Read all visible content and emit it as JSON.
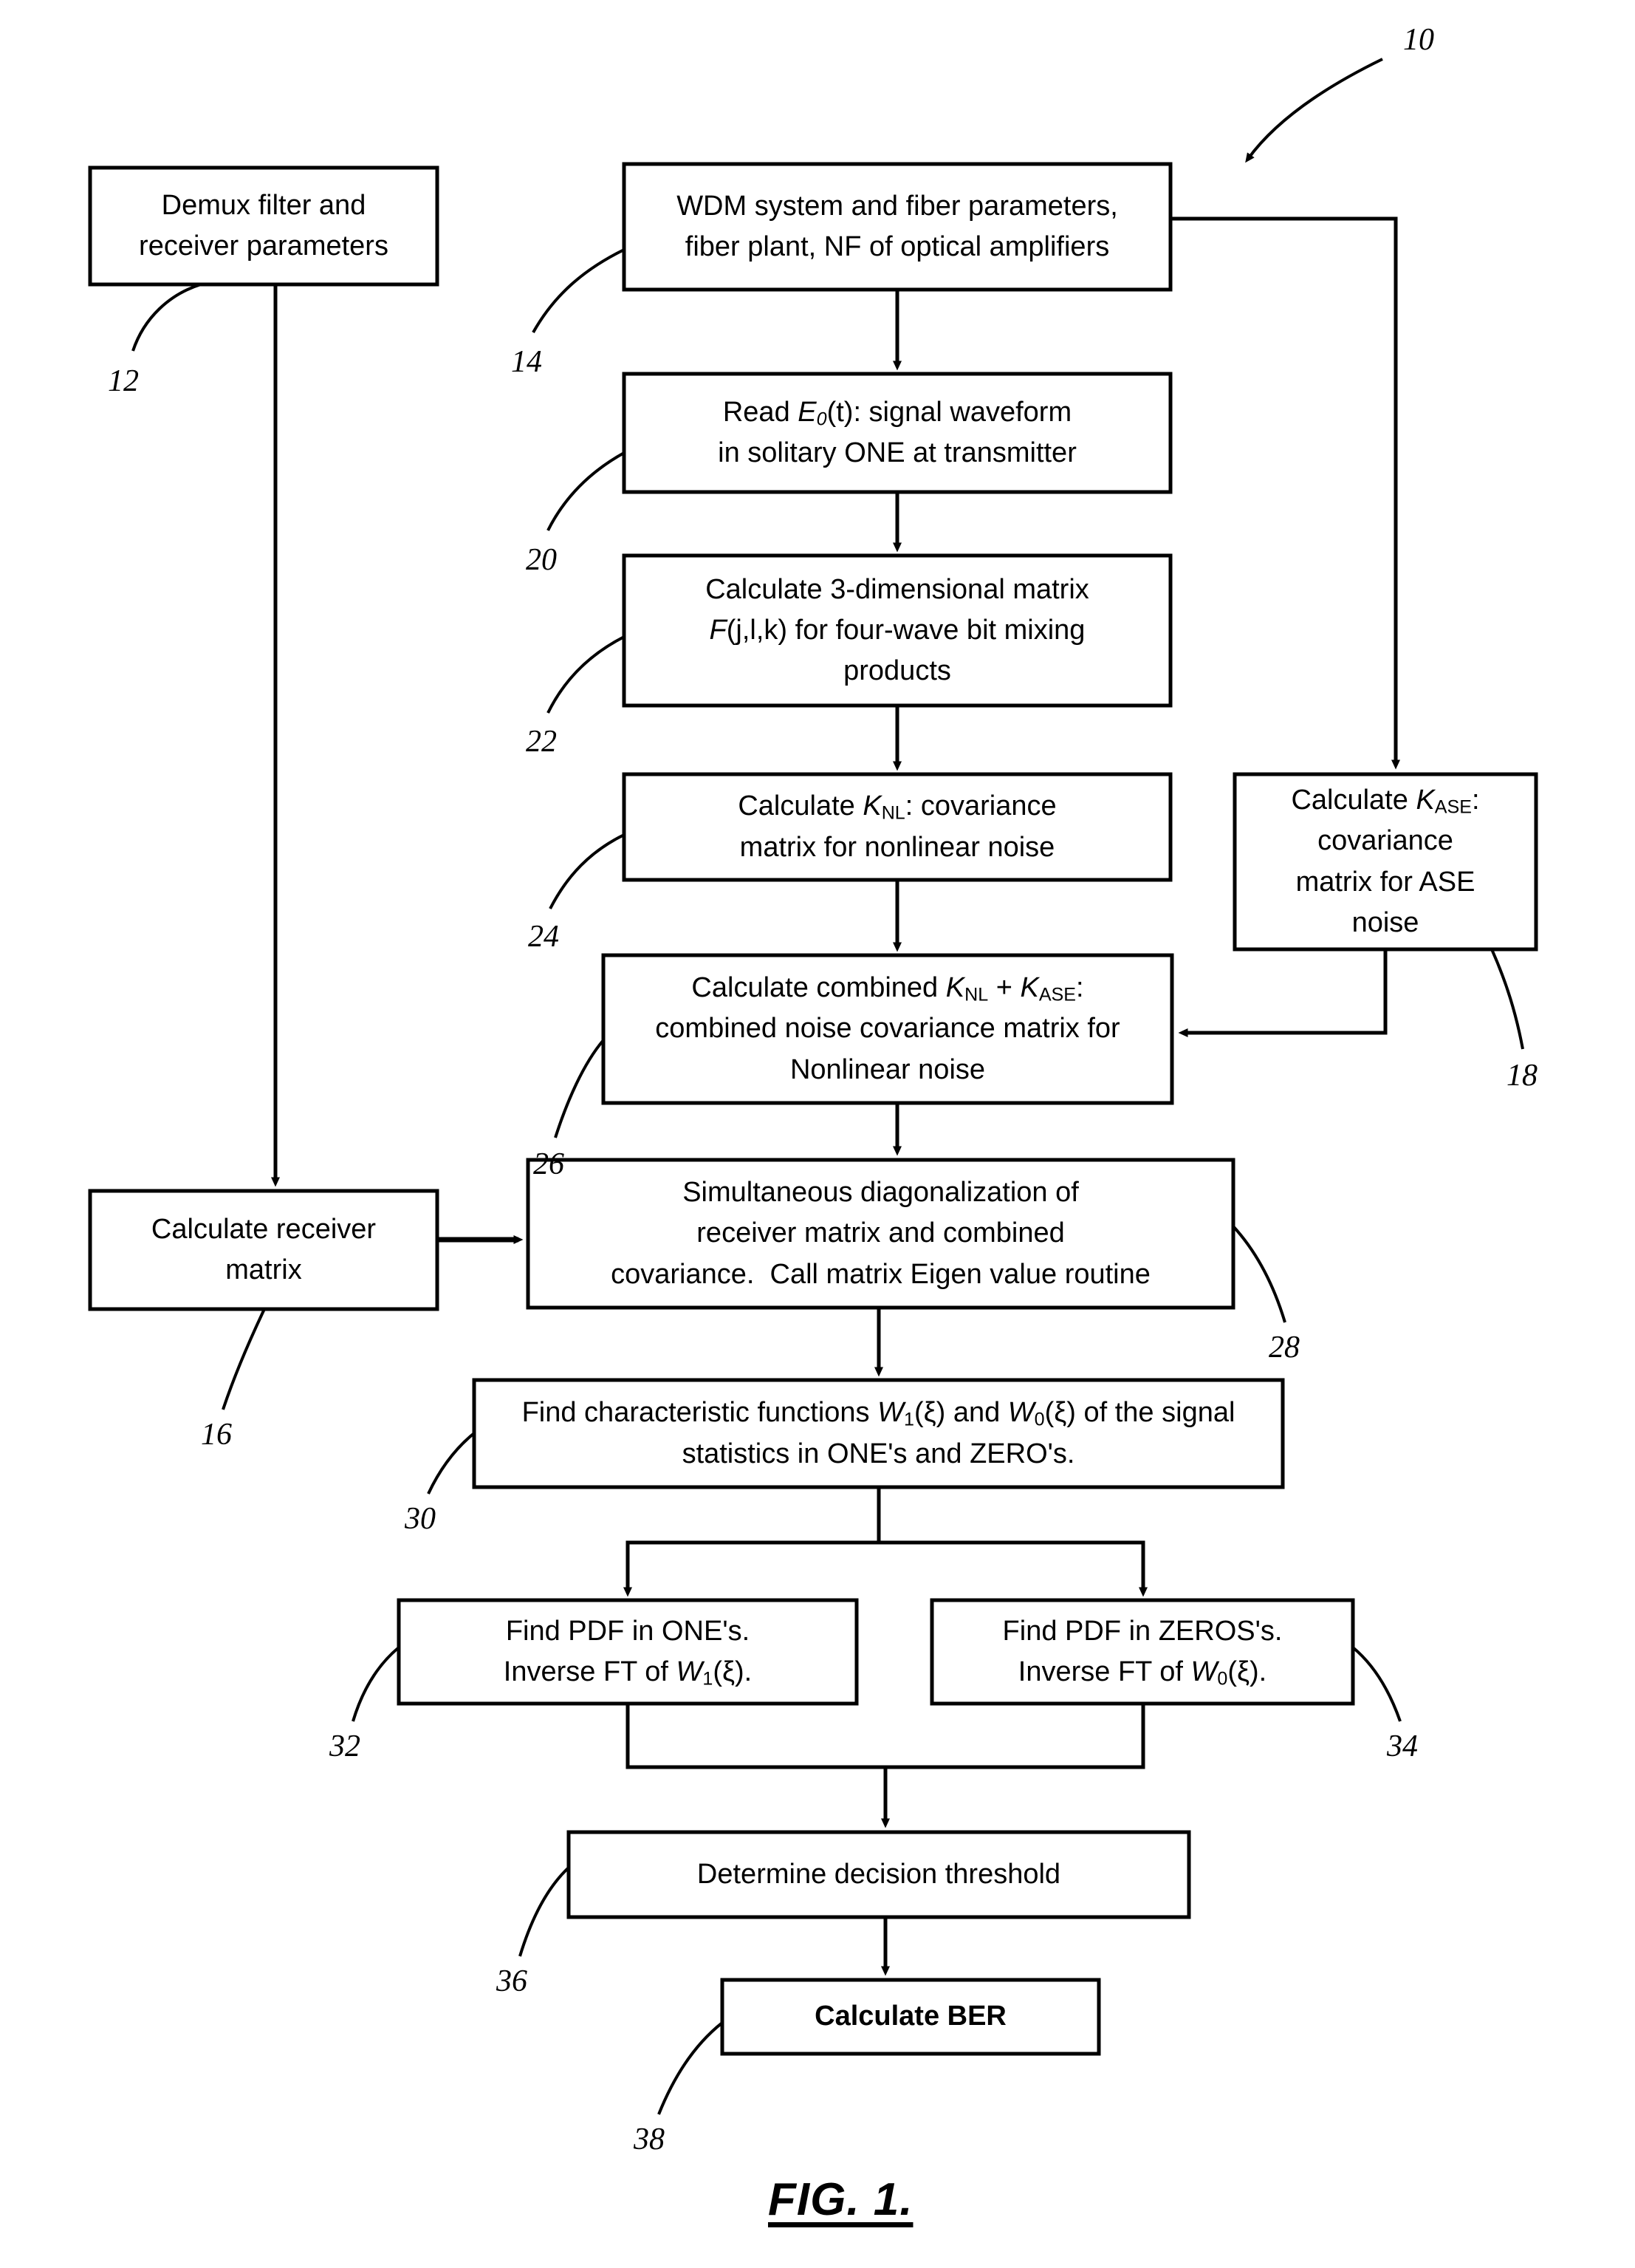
{
  "figure": {
    "caption": "FIG. 1.",
    "system_ref": "10"
  },
  "nodes": [
    {
      "id": "demux",
      "ref": "12",
      "lines": [
        "Demux filter and",
        "receiver parameters"
      ],
      "style": "plain"
    },
    {
      "id": "wdm",
      "ref": "14",
      "lines": [
        "WDM system and fiber parameters,",
        "fiber plant, NF of optical amplifiers"
      ],
      "style": "plain"
    },
    {
      "id": "read-e0",
      "ref": "20",
      "lines": [
        "Read E0(t): signal waveform",
        "in solitary ONE at transmitter"
      ],
      "html": "Read <i>E</i><sub><i>0</i></sub>(t): signal waveform<br>in solitary ONE at transmitter",
      "style": "math"
    },
    {
      "id": "matrix-f",
      "ref": "22",
      "lines": [
        "Calculate 3-dimensional matrix",
        "F(j,l,k) for four-wave bit mixing",
        "products"
      ],
      "html": "Calculate 3-dimensional matrix<br><i>F</i>(j,l,k) for four-wave bit mixing<br>products",
      "style": "math"
    },
    {
      "id": "k-nl",
      "ref": "24",
      "lines": [
        "Calculate KNL: covariance",
        "matrix for nonlinear noise"
      ],
      "html": "Calculate <i>K</i><sub>NL</sub>: covariance<br>matrix for nonlinear noise",
      "style": "math"
    },
    {
      "id": "k-ase",
      "ref": "18",
      "lines": [
        "Calculate KASE:",
        "covariance",
        "matrix for ASE",
        "noise"
      ],
      "html": "Calculate <i>K</i><sub>ASE</sub>:<br>covariance<br>matrix for ASE<br>noise",
      "style": "math"
    },
    {
      "id": "combined",
      "ref": "26",
      "lines": [
        "Calculate combined KNL + KASE:",
        "combined noise covariance matrix for",
        "Nonlinear noise"
      ],
      "html": "Calculate combined <i>K</i><sub>NL</sub> + <i>K</i><sub>ASE</sub>:<br>combined noise covariance matrix for<br>Nonlinear noise",
      "style": "math"
    },
    {
      "id": "receiver-matrix",
      "ref": "16",
      "lines": [
        "Calculate receiver",
        "matrix"
      ],
      "style": "plain"
    },
    {
      "id": "diagonalization",
      "ref": "28",
      "lines": [
        "Simultaneous diagonalization of",
        "receiver matrix and combined",
        "covariance.  Call matrix Eigen value routine"
      ],
      "html": "Simultaneous diagonalization of<br>receiver matrix and combined<br>covariance.&nbsp; Call matrix Eigen value routine",
      "style": "plain"
    },
    {
      "id": "char-functions",
      "ref": "30",
      "lines": [
        "Find characteristic functions W1(ξ) and W0(ξ) of the signal",
        "statistics in ONE's and ZERO's."
      ],
      "html": "Find characteristic functions <i>W</i><sub>1</sub>(ξ) and <i>W</i><sub>0</sub>(ξ) of the signal<br>statistics in ONE's and ZERO's.",
      "style": "math"
    },
    {
      "id": "pdf-ones",
      "ref": "32",
      "lines": [
        "Find PDF in ONE's.",
        "Inverse FT of W1(ξ)."
      ],
      "html": "Find PDF in ONE's.<br>Inverse FT of <i>W</i><sub>1</sub>(ξ).",
      "style": "math"
    },
    {
      "id": "pdf-zeros",
      "ref": "34",
      "lines": [
        "Find PDF in ZEROS's.",
        "Inverse FT of W0(ξ)."
      ],
      "html": "Find PDF in ZEROS's.<br>Inverse FT of <i>W</i><sub>0</sub>(ξ).",
      "style": "math"
    },
    {
      "id": "threshold",
      "ref": "36",
      "lines": [
        "Determine decision threshold"
      ],
      "style": "plain"
    },
    {
      "id": "ber",
      "ref": "38",
      "lines": [
        "Calculate BER"
      ],
      "style": "bold"
    }
  ],
  "colors": {
    "stroke": "#000000",
    "background": "#ffffff",
    "text": "#000000"
  }
}
